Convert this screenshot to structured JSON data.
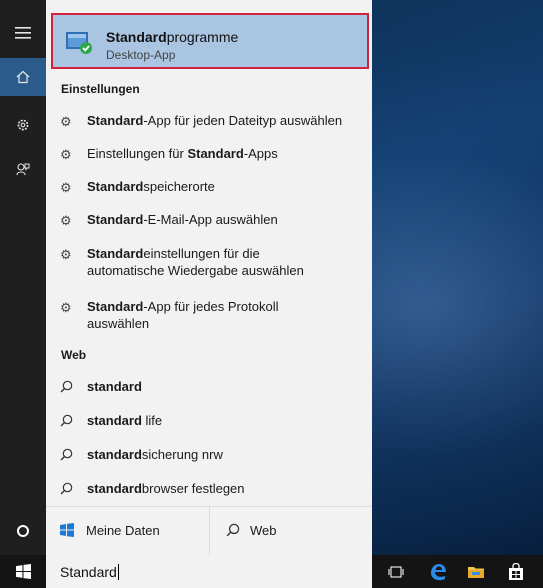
{
  "best_match": {
    "title_bold": "Standard",
    "title_rest": "programme",
    "subtitle": "Desktop-App"
  },
  "settings": {
    "header": "Einstellungen",
    "items": [
      {
        "bold": "Standard",
        "rest": "-App für jeden Dateityp auswählen",
        "pre": "",
        "icon": "gear-icon"
      },
      {
        "pre": "Einstellungen für ",
        "bold": "Standard",
        "rest": "-Apps",
        "icon": "gear-icon"
      },
      {
        "pre": "",
        "bold": "Standard",
        "rest": "speicherorte",
        "icon": "gear-icon"
      },
      {
        "pre": "",
        "bold": "Standard",
        "rest": "-E-Mail-App auswählen",
        "icon": "gear-icon"
      },
      {
        "pre": "",
        "bold": "Standard",
        "rest": "einstellungen für die",
        "line2": "automatische Wiedergabe auswählen",
        "icon": "gear-icon"
      },
      {
        "pre": "",
        "bold": "Standard",
        "rest": "-App für jedes Protokoll",
        "line2": "auswählen",
        "icon": "gear-icon"
      }
    ]
  },
  "web": {
    "header": "Web",
    "items": [
      {
        "bold": "standard",
        "rest": "",
        "icon": "search-icon"
      },
      {
        "bold": "standard",
        "rest": " life",
        "icon": "search-icon"
      },
      {
        "bold": "standard",
        "rest": "sicherung nrw",
        "icon": "search-icon"
      },
      {
        "bold": "standard",
        "rest": "browser festlegen",
        "icon": "search-icon"
      }
    ]
  },
  "scope": {
    "my_data": "Meine Daten",
    "web": "Web"
  },
  "search": {
    "value": "Standard"
  },
  "colors": {
    "highlight": "#a9c5e2",
    "outline": "#d1233b",
    "rail_active": "#2b5b8a"
  }
}
